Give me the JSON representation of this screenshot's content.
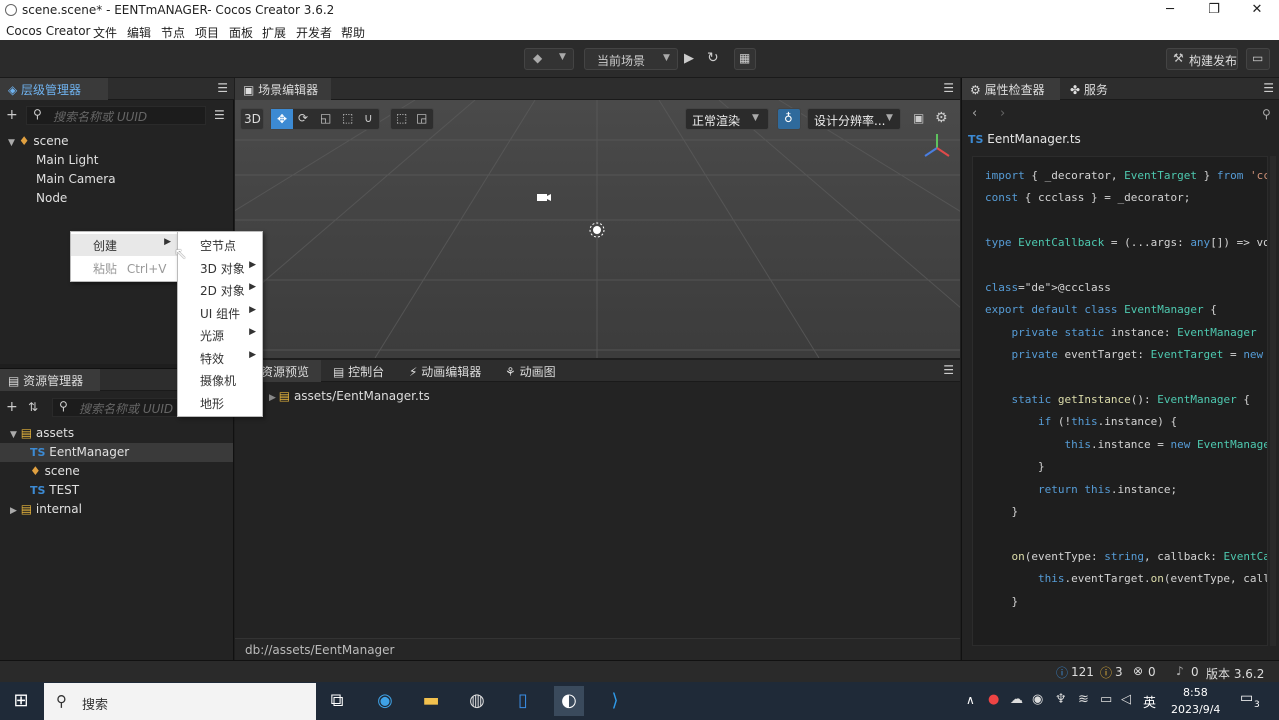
{
  "window": {
    "title": "scene.scene* - EENTmANAGER- Cocos Creator 3.6.2",
    "minimize": "─",
    "restore": "❐",
    "close": "✕"
  },
  "menu": [
    "Cocos Creator",
    "文件",
    "编辑",
    "节点",
    "项目",
    "面板",
    "扩展",
    "开发者",
    "帮助"
  ],
  "toolbar": {
    "scene_select": "当前场景",
    "build_publish": "构建发布"
  },
  "hierarchy": {
    "title": "层级管理器",
    "search_placeholder": "搜索名称或 UUID",
    "root": "scene",
    "children": [
      "Main Light",
      "Main Camera",
      "Node"
    ]
  },
  "scene_editor": {
    "title": "场景编辑器",
    "mode_3d": "3D",
    "render_mode": "正常渲染",
    "resolution": "设计分辨率..."
  },
  "assets": {
    "title": "资源管理器",
    "search_placeholder": "搜索名称或 UUID",
    "root": "assets",
    "items": [
      {
        "badge": "TS",
        "label": "EentManager"
      },
      {
        "badge": "",
        "label": "scene"
      },
      {
        "badge": "TS",
        "label": "TEST"
      }
    ],
    "internal": "internal"
  },
  "bottom_tabs": [
    "资源预览",
    "控制台",
    "动画编辑器",
    "动画图"
  ],
  "preview": {
    "breadcrumb_root": "assets",
    "breadcrumb_sep": "/",
    "breadcrumb_file": "EentManager.ts",
    "path": "db://assets/EentManager"
  },
  "inspector": {
    "tab_inspector": "属性检查器",
    "tab_service": "服务",
    "badge": "TS",
    "file": "EentManager.ts",
    "code": [
      "import { _decorator, EventTarget } from 'cc",
      "const { ccclass } = _decorator;",
      "",
      "type EventCallback = (...args: any[]) => vo",
      "",
      "@ccclass",
      "export default class EventManager {",
      "    private static instance: EventManager",
      "    private eventTarget: EventTarget = new",
      "",
      "    static getInstance(): EventManager {",
      "        if (!this.instance) {",
      "            this.instance = new EventManage",
      "        }",
      "        return this.instance;",
      "    }",
      "",
      "    on(eventType: string, callback: EventCa",
      "        this.eventTarget.on(eventType, call",
      "    }"
    ]
  },
  "status": {
    "info": "121",
    "warn": "3",
    "error": "0",
    "notify": "0",
    "version": "版本 3.6.2"
  },
  "context_menu": {
    "create": "创建",
    "paste": "粘贴",
    "paste_shortcut": "Ctrl+V"
  },
  "submenu": [
    "空节点",
    "3D 对象",
    "2D 对象",
    "UI 组件",
    "光源",
    "特效",
    "摄像机",
    "地形"
  ],
  "taskbar": {
    "search": "搜索",
    "ime": "英",
    "time": "8:58",
    "date": "2023/9/4",
    "notifications": "3"
  },
  "colors": {
    "accent_blue": "#3c8ad3",
    "panel_bg": "#232323",
    "code_bg": "#1e1e1e",
    "taskbar_bg": "#1f2a38"
  }
}
